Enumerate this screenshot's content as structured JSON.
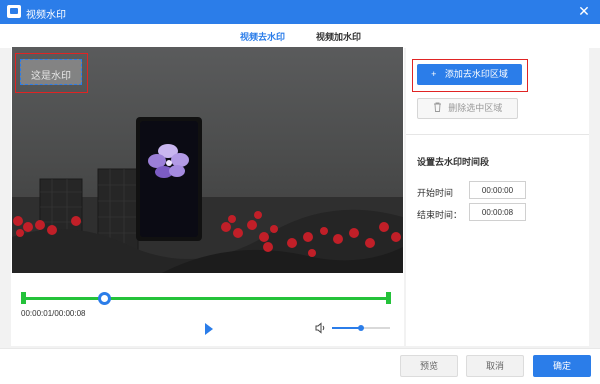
{
  "window": {
    "title": "视频水印",
    "close_glyph": "✕",
    "icon": "app-icon"
  },
  "tabs": [
    {
      "label": "视频去水印",
      "active": true
    },
    {
      "label": "视频加水印",
      "active": false
    }
  ],
  "preview": {
    "watermark_text": "这是水印",
    "timecode": "00:00:01/00:00:08",
    "progress_fraction": 0.12,
    "volume_fraction": 0.5
  },
  "right_panel": {
    "add_button_label": "添加去水印区域",
    "add_icon_glyph": "+",
    "delete_button_label": "删除选中区域",
    "delete_icon_glyph": "🗑",
    "section_title": "设置去水印时间段",
    "start_label": "开始时间",
    "start_value": "00:00:00",
    "end_label": "结束时间：",
    "end_value": "00:00:08"
  },
  "footer": {
    "preview_label": "预览",
    "cancel_label": "取消",
    "confirm_label": "确定"
  },
  "colors": {
    "accent": "#2b7de9",
    "highlight": "#e02424",
    "timeline": "#24c23a"
  }
}
